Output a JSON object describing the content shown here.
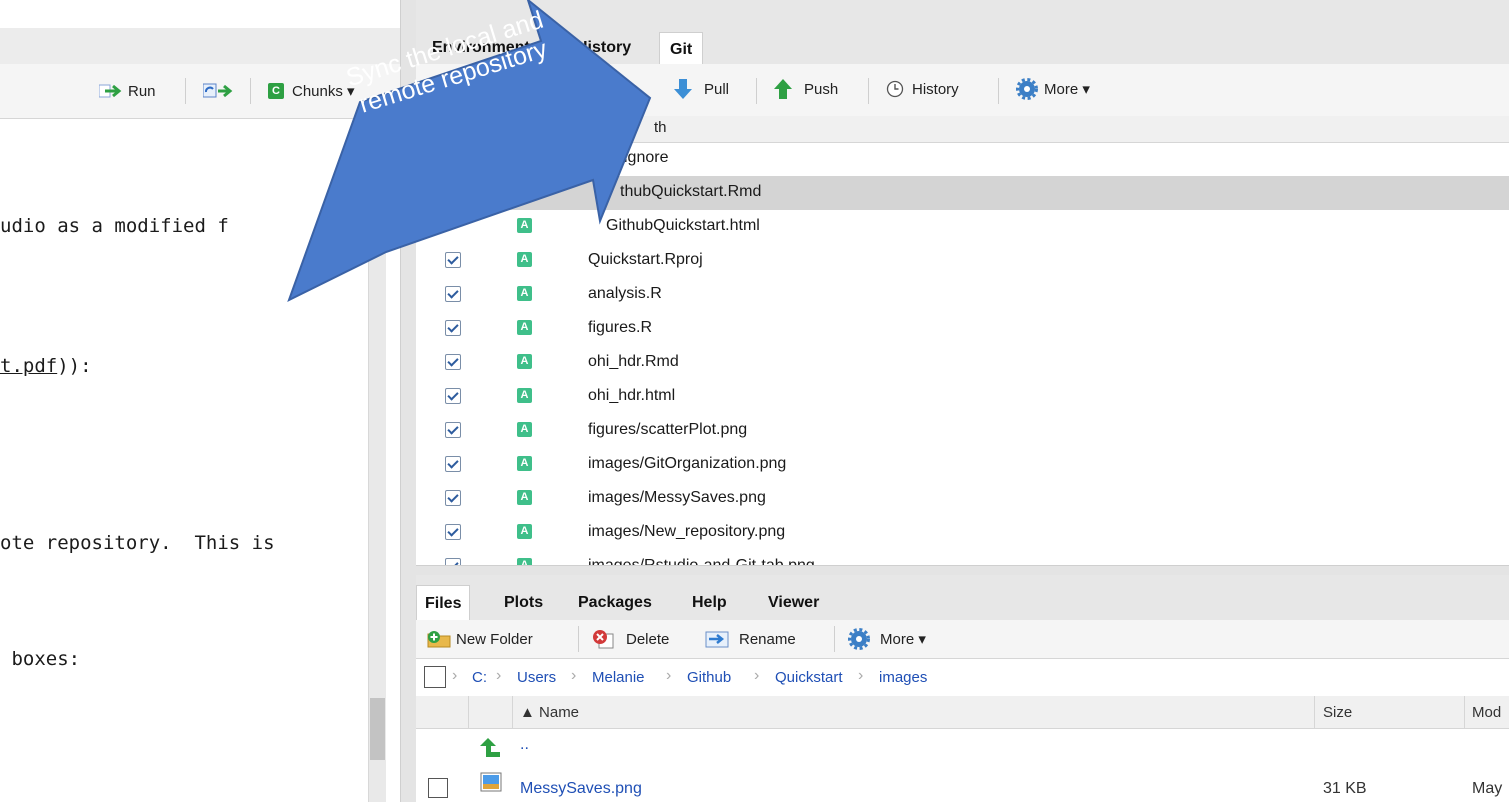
{
  "editor": {
    "toolbar": {
      "run_label": "Run",
      "chunks_label": "Chunks ▾",
      "chunks_badge": "C"
    },
    "lines": [
      "udio as a modified f",
      "t.pdf",
      ")):",
      "ote repository.  This is",
      " boxes:"
    ]
  },
  "git_pane": {
    "tabs": [
      "Environment",
      "History",
      "Git"
    ],
    "active_tab": "Git",
    "toolbar": {
      "pull": "Pull",
      "push": "Push",
      "history": "History",
      "more": "More ▾"
    },
    "path_header": "th",
    "rows": [
      {
        "path": "ignore",
        "checked": false,
        "status": ""
      },
      {
        "path": "thubQuickstart.Rmd",
        "checked": false,
        "status": ""
      },
      {
        "path": "GithubQuickstart.html",
        "checked": false,
        "status": "A"
      },
      {
        "path": "Quickstart.Rproj",
        "checked": true,
        "status": "A"
      },
      {
        "path": "analysis.R",
        "checked": true,
        "status": "A"
      },
      {
        "path": "figures.R",
        "checked": true,
        "status": "A"
      },
      {
        "path": "ohi_hdr.Rmd",
        "checked": true,
        "status": "A"
      },
      {
        "path": "ohi_hdr.html",
        "checked": true,
        "status": "A"
      },
      {
        "path": "figures/scatterPlot.png",
        "checked": true,
        "status": "A"
      },
      {
        "path": "images/GitOrganization.png",
        "checked": true,
        "status": "A"
      },
      {
        "path": "images/MessySaves.png",
        "checked": true,
        "status": "A"
      },
      {
        "path": "images/New_repository.png",
        "checked": true,
        "status": "A"
      },
      {
        "path": "images/Rstudio-and-Git-tab.png",
        "checked": true,
        "status": "A"
      }
    ]
  },
  "files_pane": {
    "tabs": [
      "Files",
      "Plots",
      "Packages",
      "Help",
      "Viewer"
    ],
    "active_tab": "Files",
    "toolbar": {
      "new_folder": "New Folder",
      "delete": "Delete",
      "rename": "Rename",
      "more": "More ▾"
    },
    "breadcrumb": [
      "C:",
      "Users",
      "Melanie",
      "Github",
      "Quickstart",
      "images"
    ],
    "columns": {
      "name": "▲ Name",
      "size": "Size",
      "modified": "Mod"
    },
    "parent_label": "..",
    "files": [
      {
        "name": "MessySaves.png",
        "size": "31 KB",
        "modified": "May"
      }
    ]
  },
  "callout": {
    "line1": "Sync the local and",
    "line2": "remote repository",
    "fill_color": "#4a7bcc",
    "stroke_color": "#3a62a6"
  }
}
